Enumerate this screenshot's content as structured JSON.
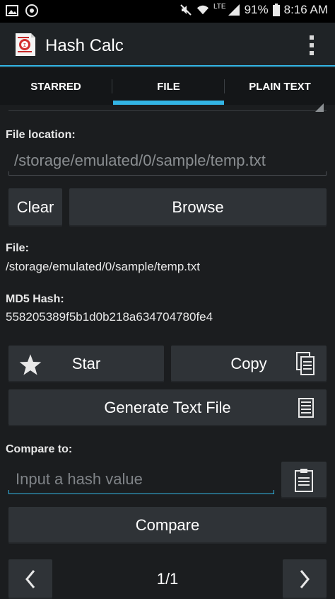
{
  "status_bar": {
    "battery": "91%",
    "time": "8:16 AM",
    "network": "LTE",
    "icons": [
      "image-icon",
      "chrome-icon",
      "mute-icon",
      "wifi-icon",
      "signal-icon",
      "battery-icon"
    ]
  },
  "app": {
    "title": "Hash Calc",
    "accent_color": "#33b5e5"
  },
  "tabs": [
    {
      "label": "STARRED",
      "selected": false
    },
    {
      "label": "FILE",
      "selected": true
    },
    {
      "label": "PLAIN TEXT",
      "selected": false
    }
  ],
  "file_location": {
    "label": "File location:",
    "value": "/storage/emulated/0/sample/temp.txt"
  },
  "buttons": {
    "clear": "Clear",
    "browse": "Browse",
    "star": "Star",
    "copy": "Copy",
    "generate": "Generate Text File",
    "compare": "Compare"
  },
  "file": {
    "label": "File:",
    "value": "/storage/emulated/0/sample/temp.txt"
  },
  "hash": {
    "label": "MD5 Hash:",
    "value": "558205389f5b1d0b218a634704780fe4"
  },
  "compare": {
    "label": "Compare to:",
    "placeholder": "Input a hash value"
  },
  "pager": {
    "text": "1/1"
  }
}
